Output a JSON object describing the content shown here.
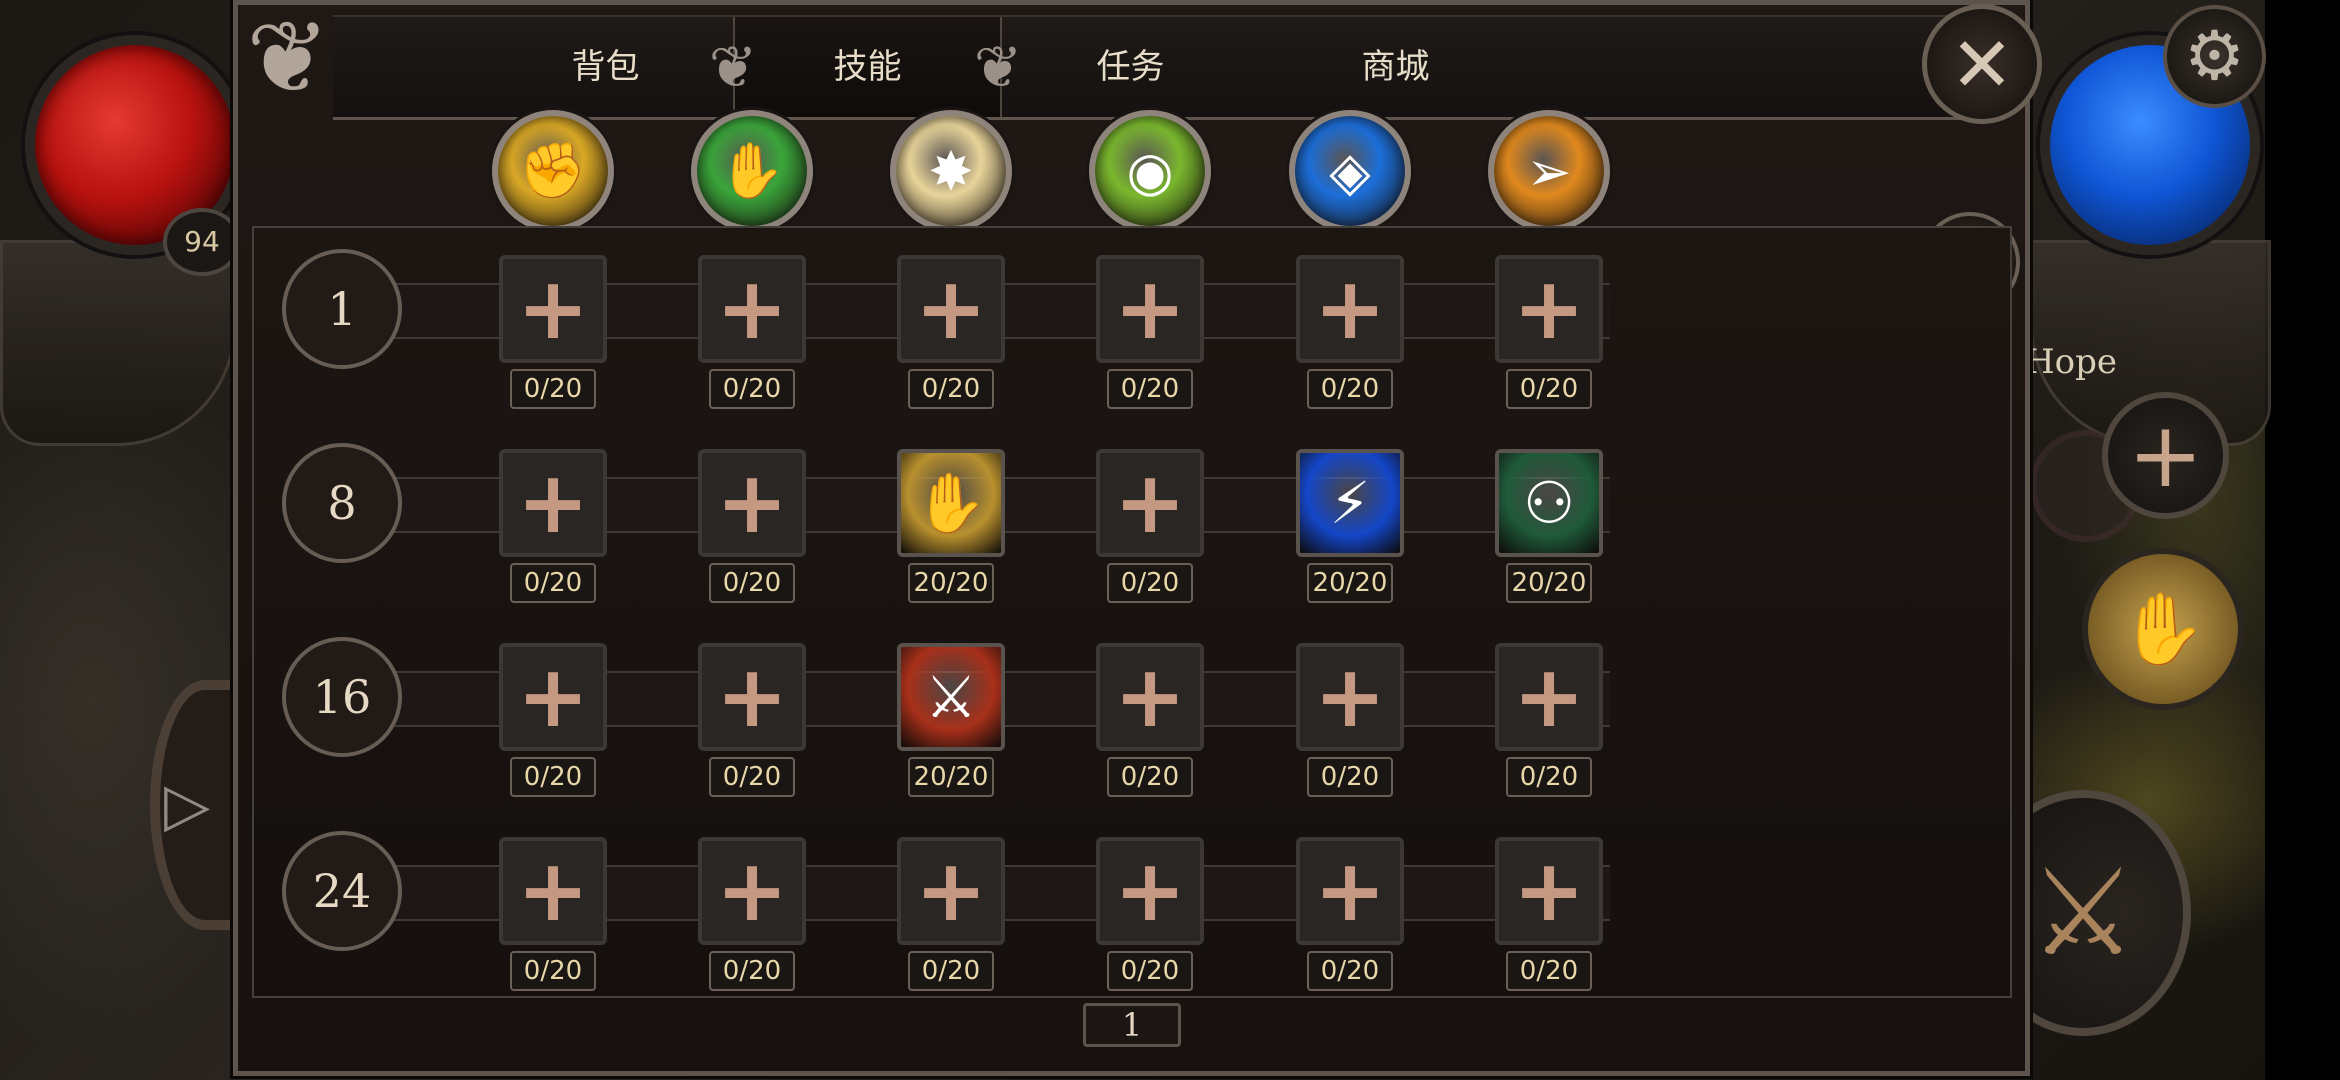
{
  "hud": {
    "player_level": "94",
    "location_partial": "Hope"
  },
  "tabs": [
    {
      "label": "背包",
      "active": false
    },
    {
      "label": "技能",
      "active": true
    },
    {
      "label": "任务",
      "active": false
    },
    {
      "label": "商城",
      "active": false
    }
  ],
  "class_icons": [
    {
      "name": "fist-skill-icon",
      "color": "#d9a825"
    },
    {
      "name": "green-claw-skill-icon",
      "color": "#3aa53a"
    },
    {
      "name": "light-hand-skill-icon",
      "color": "#e8d49a"
    },
    {
      "name": "nature-orb-skill-icon",
      "color": "#7ab82e"
    },
    {
      "name": "ice-shield-skill-icon",
      "color": "#1c6ed8"
    },
    {
      "name": "bow-skill-icon",
      "color": "#e0891e"
    }
  ],
  "skill_rows": [
    {
      "level": "1",
      "slots": [
        {
          "learned": false,
          "count": "0/20"
        },
        {
          "learned": false,
          "count": "0/20"
        },
        {
          "learned": false,
          "count": "0/20"
        },
        {
          "learned": false,
          "count": "0/20"
        },
        {
          "learned": false,
          "count": "0/20"
        },
        {
          "learned": false,
          "count": "0/20"
        }
      ]
    },
    {
      "level": "8",
      "slots": [
        {
          "learned": false,
          "count": "0/20"
        },
        {
          "learned": false,
          "count": "0/20"
        },
        {
          "learned": true,
          "icon": "holy-palm-icon",
          "color": "#b8902e",
          "count": "20/20"
        },
        {
          "learned": false,
          "count": "0/20"
        },
        {
          "learned": true,
          "icon": "lightning-bolt-icon",
          "color": "#1446c8",
          "count": "20/20"
        },
        {
          "learned": true,
          "icon": "hooded-hunter-icon",
          "color": "#1f5a3a",
          "count": "20/20"
        }
      ]
    },
    {
      "level": "16",
      "slots": [
        {
          "learned": false,
          "count": "0/20"
        },
        {
          "learned": false,
          "count": "0/20"
        },
        {
          "learned": true,
          "icon": "crossed-swords-icon",
          "color": "#a8301a",
          "count": "20/20"
        },
        {
          "learned": false,
          "count": "0/20"
        },
        {
          "learned": false,
          "count": "0/20"
        },
        {
          "learned": false,
          "count": "0/20"
        }
      ]
    },
    {
      "level": "24",
      "slots": [
        {
          "learned": false,
          "count": "0/20"
        },
        {
          "learned": false,
          "count": "0/20"
        },
        {
          "learned": false,
          "count": "0/20"
        },
        {
          "learned": false,
          "count": "0/20"
        },
        {
          "learned": false,
          "count": "0/20"
        },
        {
          "learned": false,
          "count": "0/20"
        }
      ]
    }
  ],
  "pagination": {
    "current_page": "1"
  }
}
